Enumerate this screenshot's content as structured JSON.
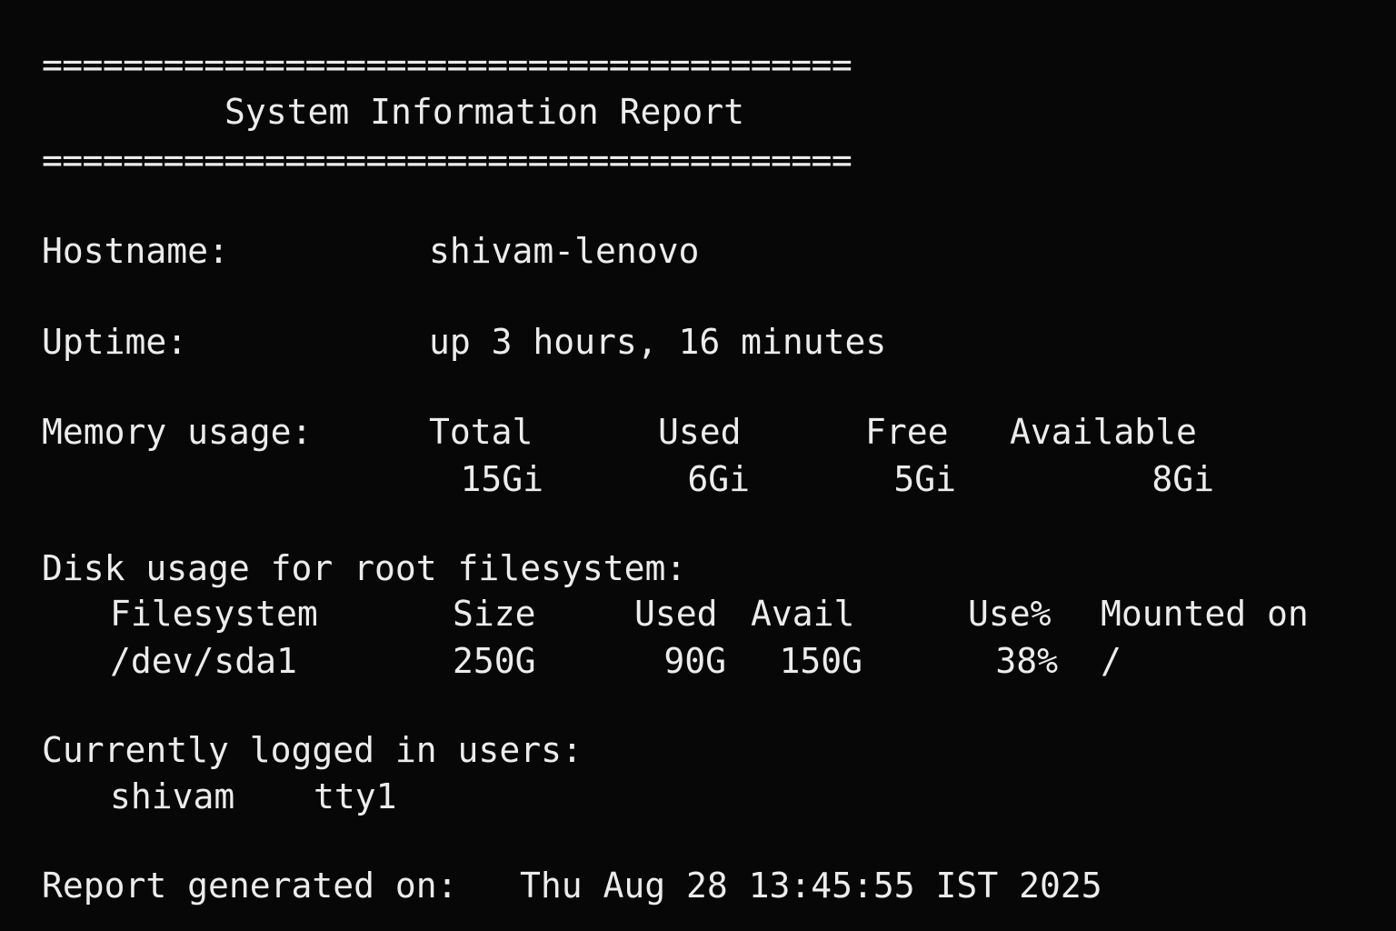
{
  "header": {
    "separator_top": "========================================",
    "title": "System Information Report",
    "separator_bottom": "========================================"
  },
  "hostname": {
    "label": "Hostname:",
    "value": "shivam-lenovo"
  },
  "uptime": {
    "label": "Uptime:",
    "value": "up 3 hours, 16 minutes"
  },
  "memory": {
    "label": "Memory usage:",
    "headers": [
      "Total",
      "Used",
      "Free",
      "Available"
    ],
    "values": [
      "15Gi",
      "6Gi",
      "5Gi",
      "8Gi"
    ]
  },
  "disk": {
    "label": "Disk usage for root filesystem:",
    "headers": [
      "Filesystem",
      "Size",
      "Used",
      "Avail",
      "Use%",
      "Mounted on"
    ],
    "row": [
      "/dev/sda1",
      "250G",
      "90G",
      "150G",
      "38%",
      "/"
    ]
  },
  "users": {
    "label": "Currently logged in users:",
    "entries": [
      {
        "user": "shivam",
        "tty": "tty1"
      }
    ]
  },
  "footer": {
    "generated_label": "Report generated on:",
    "generated_value": "Thu Aug 28 13:45:55 IST 2025"
  }
}
